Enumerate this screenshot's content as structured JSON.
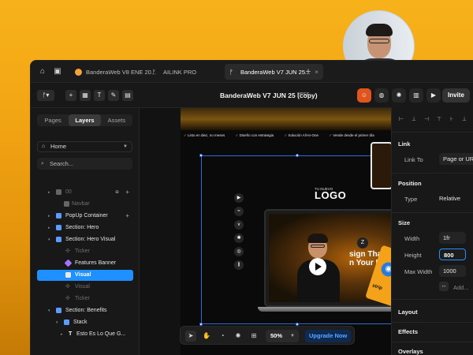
{
  "tabs": [
    {
      "label": "BanderaWeb V8 ENE 20...",
      "color": "#f2a43a",
      "active": false
    },
    {
      "label": "AILINK PRO",
      "color": "#cfcfcf",
      "active": false
    },
    {
      "label": "BanderaWeb V7 JUN 25...",
      "color": "#ffffff",
      "active": true
    }
  ],
  "toolbar": {
    "doc_title": "BanderaWeb V7 JUN 25 (copy)",
    "plan": "FREE",
    "invite_label": "Invite"
  },
  "left_panel": {
    "tabs": [
      "Pages",
      "Layers",
      "Assets"
    ],
    "active_tab": "Layers",
    "page_select": "Home",
    "search_placeholder": "Search...",
    "layers": [
      {
        "label": "00",
        "dim": true,
        "indent": 0
      },
      {
        "label": "Navbar",
        "dim": true,
        "indent": 1
      },
      {
        "label": "PopUp Container",
        "dim": false,
        "indent": 1
      },
      {
        "label": "Section: Hero",
        "dim": false,
        "indent": 1
      },
      {
        "label": "Section: Hero Visual",
        "dim": false,
        "indent": 1
      },
      {
        "label": "Ticker",
        "dim": true,
        "indent": 2
      },
      {
        "label": "Features Banner",
        "dim": false,
        "indent": 2
      },
      {
        "label": "Visual",
        "dim": false,
        "indent": 2,
        "selected": true
      },
      {
        "label": "Visual",
        "dim": true,
        "indent": 2
      },
      {
        "label": "Ticker",
        "dim": true,
        "indent": 2
      },
      {
        "label": "Section: Benefits",
        "dim": false,
        "indent": 1
      },
      {
        "label": "Stack",
        "dim": false,
        "indent": 2
      },
      {
        "label": "Esto Es Lo Que G...",
        "dim": false,
        "indent": 3
      }
    ]
  },
  "canvas": {
    "ticker_items": [
      "Listo en diez, no meses",
      "Diseño con estrategia",
      "Solución All-In-One",
      "Vende desde el primer día"
    ],
    "logo_small": "TU NUEVO",
    "logo_big": "LOGO",
    "headline_1": "sign That Puts",
    "headline_2": "n Your Pocket",
    "stripe_text": "strip",
    "zbadge": "Z"
  },
  "bottom_toolbar": {
    "zoom": "50%",
    "upgrade_label": "Upgrade Now"
  },
  "right_panel": {
    "link_section": "Link",
    "link_to_label": "Link To",
    "link_to_value": "Page or URL...",
    "position_section": "Position",
    "type_label": "Type",
    "type_value": "Relative",
    "size_section": "Size",
    "width_label": "Width",
    "width_value": "1fr",
    "height_label": "Height",
    "height_value": "800",
    "max_width_label": "Max Width",
    "max_width_value": "1000",
    "add_label": "Add...",
    "layout_section": "Layout",
    "effects_section": "Effects",
    "overlays_section": "Overlays"
  },
  "colors": {
    "accent": "#1e90ff",
    "brand_orange": "#f3a614",
    "selection_outline": "#2f6bd6"
  }
}
